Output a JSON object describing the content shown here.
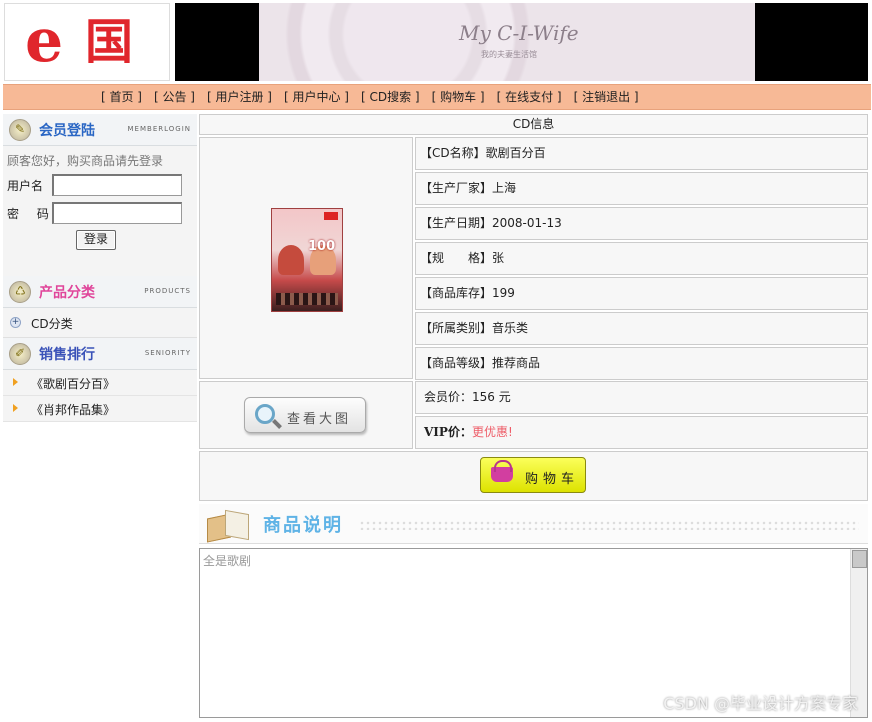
{
  "header": {
    "logo": {
      "e": "e",
      "guo": "国"
    },
    "banner": {
      "brand": "My C-I-Wife",
      "sub": "我的夫妻生活馆"
    }
  },
  "nav": [
    "[ 首页 ]",
    "[ 公告 ]",
    "[ 用户注册 ]",
    "[ 用户中心 ]",
    "[ CD搜索 ]",
    "[ 购物车 ]",
    "[ 在线支付 ]",
    "[ 注销退出 ]"
  ],
  "sidebar": {
    "member": {
      "title": "会员登陆",
      "en": "MEMBERLOGIN",
      "hint": "顾客您好，购买商品请先登录",
      "username_label": "用户名",
      "password_label": "密 码",
      "username_value": "",
      "password_value": "",
      "login_label": "登录"
    },
    "products": {
      "title": "产品分类",
      "en": "PRODUCTS",
      "items": [
        "CD分类"
      ]
    },
    "ranking": {
      "title": "销售排行",
      "en": "SENIORITY",
      "items": [
        "《歌剧百分百》",
        "《肖邦作品集》"
      ]
    }
  },
  "main": {
    "header": "CD信息",
    "cover": {
      "badge": "100"
    },
    "info": [
      "【CD名称】歌剧百分百",
      "【生产厂家】上海",
      "【生产日期】2008-01-13",
      "【规　　格】张",
      "【商品库存】199",
      "【所属类别】音乐类",
      "【商品等级】推荐商品"
    ],
    "member_price": "会员价：156 元",
    "vip_label": "VIP价：",
    "vip_value": "更优惠!",
    "view_large_label": "查看大图",
    "cart_label": "购物车",
    "desc_title": "商品说明",
    "desc_text": "全是歌剧"
  },
  "watermark": "CSDN @毕业设计方案专家",
  "colors": {
    "nav_bg": "#f7b996",
    "logo_red": "#e0262c",
    "vip_red": "#ee5d68",
    "cart_yellow": "#eef200"
  }
}
